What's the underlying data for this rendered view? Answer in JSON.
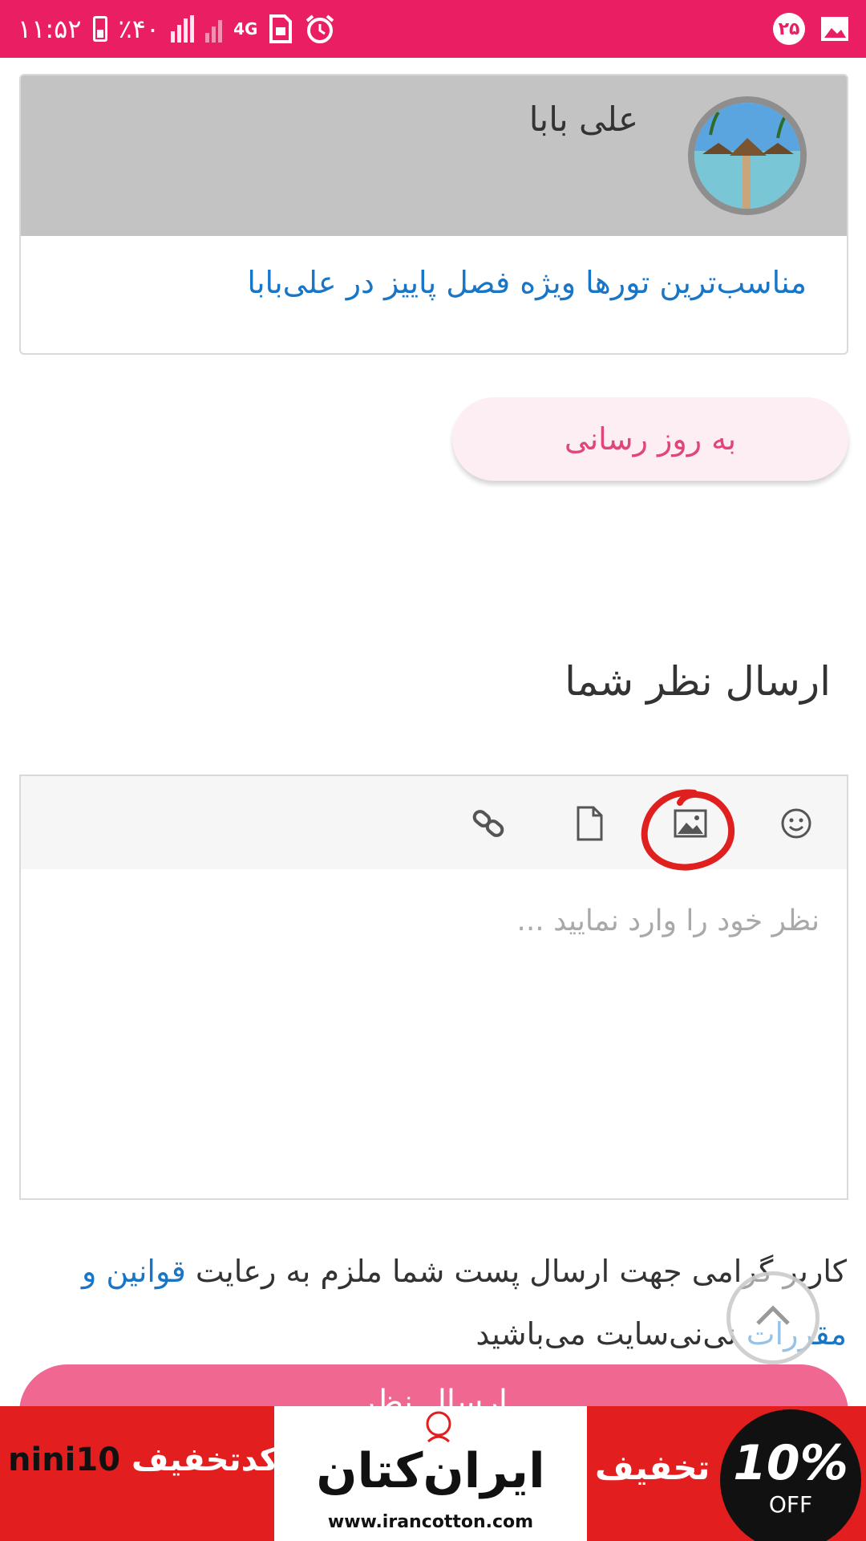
{
  "status_bar": {
    "time": "۱۱:۵۲",
    "battery": "٪۴۰",
    "network": "4G",
    "notification_count": "۲۵"
  },
  "card": {
    "author": "علی بابا",
    "post_link": "مناسب‌ترین تورها ویژه فصل پاییز در علی‌بابا",
    "avatar_icon": "beach-resort-image"
  },
  "update_button": "به روز رسانی",
  "comment_section": {
    "title": "ارسال نظر شما",
    "placeholder": "نظر خود را وارد نمایید ...",
    "toolbar_icons": [
      "emoji-icon",
      "image-icon",
      "file-icon",
      "link-icon"
    ],
    "annotation_color": "#e0201e"
  },
  "notice": {
    "text": "کاربر گرامی جهت ارسال پست شما ملزم به رعایت",
    "link": "قوانین و مقررات",
    "suffix": "نی‌نی‌سایت می‌باشید"
  },
  "send_button": "ارسال نظر",
  "ad": {
    "code_label": "کدتخفیف",
    "code": "nini10",
    "brand": "ایران‌کتان",
    "url": "www.irancotton.com",
    "discount_label": "تخفیف",
    "percent": "10%",
    "off": "OFF"
  },
  "colors": {
    "accent": "#e91e63",
    "link": "#1976c6",
    "ad_red": "#e31e1f"
  }
}
